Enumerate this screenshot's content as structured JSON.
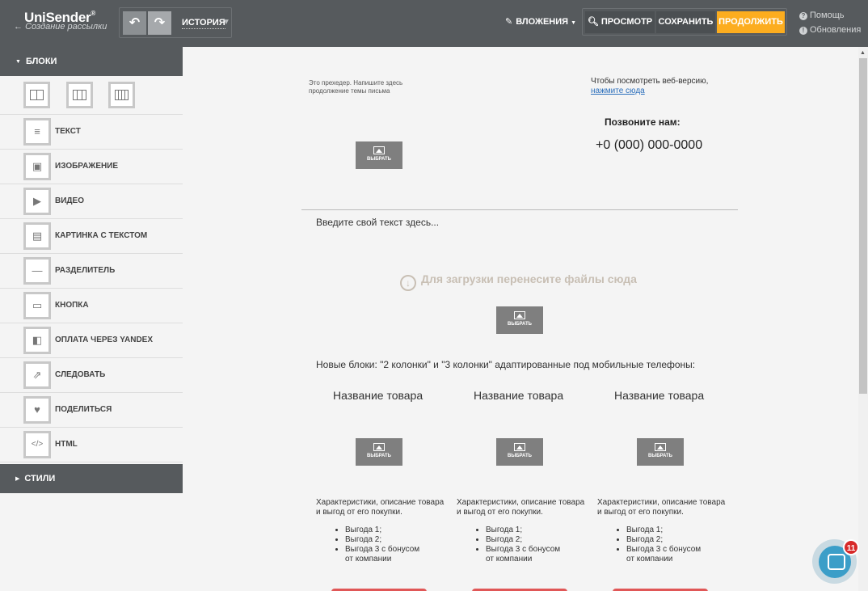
{
  "header": {
    "logo": "UniSender",
    "logo_mark": "®",
    "back_label": "Создание рассылки",
    "history_label": "ИСТОРИЯ",
    "attachments_label": "ВЛОЖЕНИЯ",
    "preview_label": "ПРОСМОТР",
    "save_label": "СОХРАНИТЬ",
    "continue_label": "ПРОДОЛЖИТЬ",
    "help_label": "Помощь",
    "updates_label": "Обновления",
    "accent_color": "#fcad1f"
  },
  "sidebar": {
    "blocks_header": "БЛОКИ",
    "styles_header": "СТИЛИ",
    "layouts": [
      {
        "icon": "one-column-icon",
        "cols": 1
      },
      {
        "icon": "two-columns-icon",
        "cols": 2
      },
      {
        "icon": "three-columns-icon",
        "cols": 3
      }
    ],
    "items": [
      {
        "label": "ТЕКСТ",
        "icon": "text-icon"
      },
      {
        "label": "ИЗОБРАЖЕНИЕ",
        "icon": "image-icon"
      },
      {
        "label": "ВИДЕО",
        "icon": "video-icon"
      },
      {
        "label": "КАРТИНКА С ТЕКСТОМ",
        "icon": "image-text-icon"
      },
      {
        "label": "РАЗДЕЛИТЕЛЬ",
        "icon": "divider-icon"
      },
      {
        "label": "КНОПКА",
        "icon": "button-icon"
      },
      {
        "label": "ОПЛАТА ЧЕРЕЗ YANDEX",
        "icon": "yandex-pay-icon"
      },
      {
        "label": "СЛЕДОВАТЬ",
        "icon": "follow-icon"
      },
      {
        "label": "ПОДЕЛИТЬСЯ",
        "icon": "share-icon"
      },
      {
        "label": "HTML",
        "icon": "html-icon"
      }
    ]
  },
  "canvas": {
    "preheader": "Это прехедер. Напишите здесь продолжение темы письма",
    "webversion_text": "Чтобы посмотреть веб-версию,",
    "webversion_link": "нажмите сюда",
    "call_us": "Позвоните нам:",
    "phone": "+0 (000) 000-0000",
    "choose_label": "ВЫБРАТЬ",
    "text_placeholder": "Введите свой текст здесь...",
    "dropzone": "Для загрузки перенесите файлы сюда",
    "new_blocks": "Новые блоки: \"2 колонки\" и \"3 колонки\" адаптированные под мобильные телефоны:",
    "products": [
      {
        "title": "Название товара",
        "desc": "Характеристики, описание товара и выгод от его покупки.",
        "benefits": [
          "Выгода 1;",
          "Выгода 2;",
          "Выгода 3 с бонусом от компании"
        ]
      },
      {
        "title": "Название товара",
        "desc": "Характеристики, описание товара и выгод от его покупки.",
        "benefits": [
          "Выгода 1;",
          "Выгода 2;",
          "Выгода 3 с бонусом от компании"
        ]
      },
      {
        "title": "Название товара",
        "desc": "Характеристики, описание товара и выгод от его покупки.",
        "benefits": [
          "Выгода 1;",
          "Выгода 2;",
          "Выгода 3 с бонусом от компании"
        ]
      }
    ]
  },
  "chat": {
    "badge": "11"
  }
}
